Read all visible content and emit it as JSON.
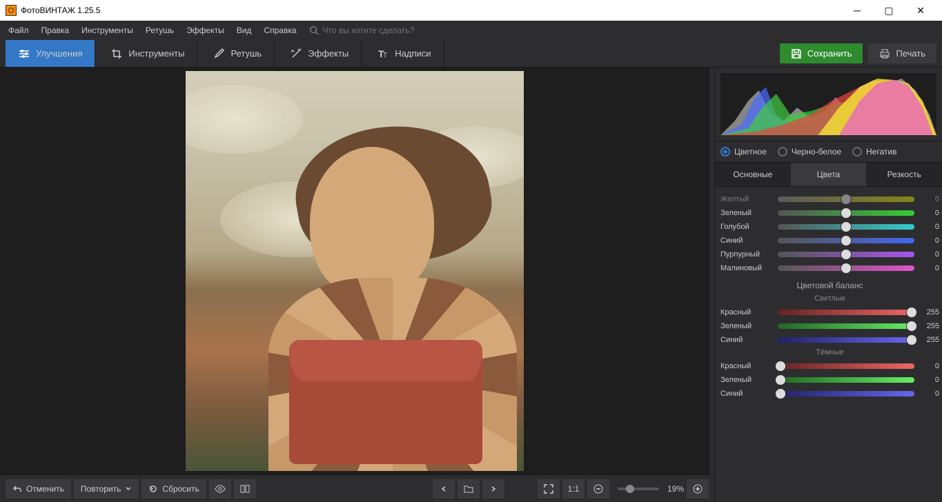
{
  "title": "ФотоВИНТАЖ 1.25.5",
  "menu": {
    "file": "Файл",
    "edit": "Правка",
    "tools": "Инструменты",
    "retouch": "Ретушь",
    "effects": "Эффекты",
    "view": "Вид",
    "help": "Справка"
  },
  "search": {
    "placeholder": "Что вы хотите сделать?"
  },
  "tabs": {
    "enhance": "Улучшения",
    "tools": "Инструменты",
    "retouch": "Ретушь",
    "effects": "Эффекты",
    "text": "Надписи"
  },
  "actions": {
    "save": "Сохранить",
    "print": "Печать"
  },
  "footer": {
    "undo": "Отменить",
    "redo": "Повторить",
    "reset": "Сбросить",
    "ratio": "1:1",
    "zoom": "19%"
  },
  "colorMode": {
    "color": "Цветное",
    "bw": "Черно-белое",
    "negative": "Негатив"
  },
  "subTabs": {
    "basic": "Основные",
    "colors": "Цвета",
    "sharpness": "Резкость"
  },
  "sliders": {
    "yellow": {
      "label": "Желтый",
      "val": "0"
    },
    "green": {
      "label": "Зеленый",
      "val": "0"
    },
    "cyan": {
      "label": "Голубой",
      "val": "0"
    },
    "blue": {
      "label": "Синий",
      "val": "0"
    },
    "purple": {
      "label": "Пурпурный",
      "val": "0"
    },
    "magenta": {
      "label": "Малиновый",
      "val": "0"
    }
  },
  "sections": {
    "balance": "Цветовой баланс",
    "highlights": "Светлые",
    "shadows": "Тёмные"
  },
  "balance": {
    "hl_red": {
      "label": "Красный",
      "val": "255"
    },
    "hl_green": {
      "label": "Зеленый",
      "val": "255"
    },
    "hl_blue": {
      "label": "Синий",
      "val": "255"
    },
    "sh_red": {
      "label": "Красный",
      "val": "0"
    },
    "sh_green": {
      "label": "Зеленый",
      "val": "0"
    },
    "sh_blue": {
      "label": "Синий",
      "val": "0"
    }
  }
}
